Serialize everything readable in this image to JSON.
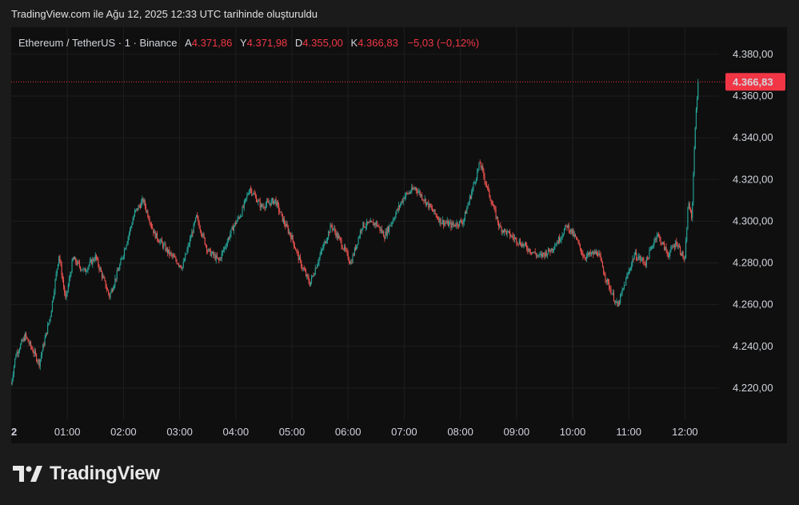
{
  "caption": "TradingView.com ile Ağu 12, 2025 12:33 UTC tarihinde oluşturuldu",
  "legend": {
    "symbol": "Ethereum / TetherUS · 1 · Binance",
    "open_label": "A",
    "open_value": "4.371,86",
    "high_label": "Y",
    "high_value": "4.371,98",
    "low_label": "D",
    "low_value": "4.355,00",
    "close_label": "K",
    "close_value": "4.366,83",
    "change": "−5,03 (−0,12%)"
  },
  "brand": {
    "name": "TradingView"
  },
  "colors": {
    "up": "#26a69a",
    "down": "#ef5350",
    "price_line": "#f23645",
    "background": "#0f0f0f",
    "grid": "#1f1f1f"
  },
  "chart_data": {
    "type": "candlestick",
    "x_ticks": [
      "2",
      "01:00",
      "02:00",
      "03:00",
      "04:00",
      "05:00",
      "06:00",
      "07:00",
      "08:00",
      "09:00",
      "10:00",
      "11:00",
      "12:00"
    ],
    "y_ticks": [
      4220,
      4240,
      4260,
      4280,
      4300,
      4320,
      4340,
      4360,
      4380
    ],
    "y_tick_labels": [
      "4.220,00",
      "4.240,00",
      "4.260,00",
      "4.280,00",
      "4.300,00",
      "4.320,00",
      "4.340,00",
      "4.360,00",
      "4.380,00"
    ],
    "ylim": [
      4205,
      4393
    ],
    "last_price": 4366.83,
    "last_price_label": "4.366,83",
    "close_path": [
      [
        0,
        4222
      ],
      [
        0.08,
        4236
      ],
      [
        0.25,
        4245
      ],
      [
        0.5,
        4232
      ],
      [
        0.7,
        4255
      ],
      [
        0.85,
        4284
      ],
      [
        0.97,
        4262
      ],
      [
        1.1,
        4282
      ],
      [
        1.3,
        4276
      ],
      [
        1.5,
        4283
      ],
      [
        1.75,
        4264
      ],
      [
        1.95,
        4280
      ],
      [
        2.2,
        4304
      ],
      [
        2.35,
        4310
      ],
      [
        2.55,
        4294
      ],
      [
        2.8,
        4285
      ],
      [
        3.05,
        4278
      ],
      [
        3.3,
        4302
      ],
      [
        3.5,
        4286
      ],
      [
        3.7,
        4281
      ],
      [
        3.95,
        4297
      ],
      [
        4.1,
        4304
      ],
      [
        4.25,
        4316
      ],
      [
        4.45,
        4307
      ],
      [
        4.7,
        4310
      ],
      [
        4.85,
        4300
      ],
      [
        5.0,
        4292
      ],
      [
        5.15,
        4280
      ],
      [
        5.32,
        4270
      ],
      [
        5.45,
        4280
      ],
      [
        5.7,
        4298
      ],
      [
        5.85,
        4291
      ],
      [
        6.05,
        4280
      ],
      [
        6.25,
        4298
      ],
      [
        6.5,
        4299
      ],
      [
        6.65,
        4293
      ],
      [
        6.8,
        4301
      ],
      [
        7.0,
        4312
      ],
      [
        7.2,
        4316
      ],
      [
        7.45,
        4307
      ],
      [
        7.65,
        4300
      ],
      [
        7.85,
        4298
      ],
      [
        8.05,
        4300
      ],
      [
        8.35,
        4328
      ],
      [
        8.5,
        4314
      ],
      [
        8.7,
        4297
      ],
      [
        9.0,
        4291
      ],
      [
        9.2,
        4287
      ],
      [
        9.4,
        4283
      ],
      [
        9.6,
        4286
      ],
      [
        9.75,
        4291
      ],
      [
        9.9,
        4298
      ],
      [
        10.05,
        4292
      ],
      [
        10.2,
        4283
      ],
      [
        10.45,
        4285
      ],
      [
        10.6,
        4272
      ],
      [
        10.8,
        4259
      ],
      [
        11.0,
        4276
      ],
      [
        11.1,
        4284
      ],
      [
        11.3,
        4280
      ],
      [
        11.5,
        4294
      ],
      [
        11.7,
        4284
      ],
      [
        11.85,
        4290
      ],
      [
        12.0,
        4281
      ],
      [
        12.06,
        4310
      ],
      [
        12.12,
        4300
      ],
      [
        12.18,
        4345
      ],
      [
        12.24,
        4367
      ]
    ]
  }
}
